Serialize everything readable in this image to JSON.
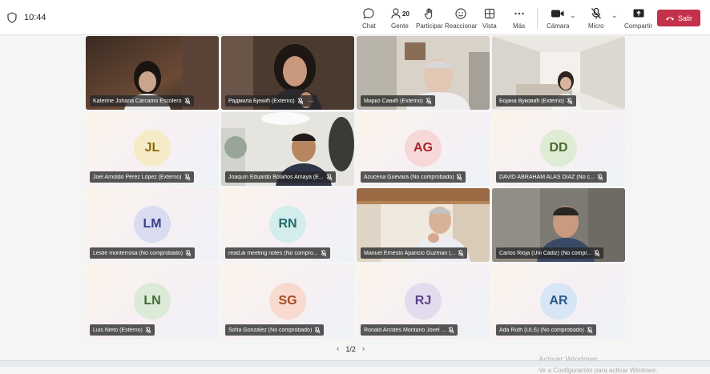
{
  "window": {
    "time": "10:44"
  },
  "toolbar": {
    "chat": "Chat",
    "people": "Gente",
    "people_count": "20",
    "raise": "Participar",
    "react": "Reaccionar",
    "view": "Vista",
    "more": "Más",
    "camera": "Cámara",
    "mic": "Micro",
    "share": "Compartir",
    "leave": "Salir"
  },
  "tiles": [
    {
      "name": "Katerine Johana Cárcamo Escolero",
      "type": "video"
    },
    {
      "name": "Радмила Бјекић (Externo)",
      "type": "video",
      "more": "···"
    },
    {
      "name": "Мирко Савић (Externo)",
      "type": "video"
    },
    {
      "name": "Бојана Вуковић (Externo)",
      "type": "video"
    },
    {
      "name": "Joel Arnoldo Pérez López (Externo)",
      "type": "avatar",
      "initials": "JL",
      "bg": "#f6ebc7",
      "fg": "#8a6a10"
    },
    {
      "name": "Joaquín Eduardo Bolaños Amaya (E...",
      "type": "video"
    },
    {
      "name": "Azucena Guevara (No comprobado)",
      "type": "avatar",
      "initials": "AG",
      "bg": "#f6d8d8",
      "fg": "#a4262c"
    },
    {
      "name": "DAVID ABRAHAM ALAS DIAZ (No c...",
      "type": "avatar",
      "initials": "DD",
      "bg": "#dfecd4",
      "fg": "#4a6b2d"
    },
    {
      "name": "Leslie monterrosa (No comprobado)",
      "type": "avatar",
      "initials": "LM",
      "bg": "#d9dcf1",
      "fg": "#3b3f8f"
    },
    {
      "name": "read.ai meeting notes (No compro...",
      "type": "avatar",
      "initials": "RN",
      "bg": "#d3ecec",
      "fg": "#1f6b6b"
    },
    {
      "name": "Manuel Ernesto Aparicio Guzman (...",
      "type": "video"
    },
    {
      "name": "Carlos Rioja (Uni Cádiz) (No compr...",
      "type": "video"
    },
    {
      "name": "Luis Nieto (Externo)",
      "type": "avatar",
      "initials": "LN",
      "bg": "#dcead8",
      "fg": "#3f6b34"
    },
    {
      "name": "Sofía González (No comprobado)",
      "type": "avatar",
      "initials": "SG",
      "bg": "#f9dad0",
      "fg": "#a3471f"
    },
    {
      "name": "Ronald Arcides Montano Jovel ...",
      "type": "avatar",
      "initials": "RJ",
      "bg": "#e3dcef",
      "fg": "#5b3f8a"
    },
    {
      "name": "Ada Ruth (ULS) (No comprobado)",
      "type": "avatar",
      "initials": "AR",
      "bg": "#d6e6f5",
      "fg": "#2a5a8a"
    }
  ],
  "pager": {
    "label": "1/2",
    "prev": "‹",
    "next": "›"
  },
  "watermark": {
    "line1": "Activar Windows",
    "line2": "Ve a Configuración para activar Windows."
  }
}
